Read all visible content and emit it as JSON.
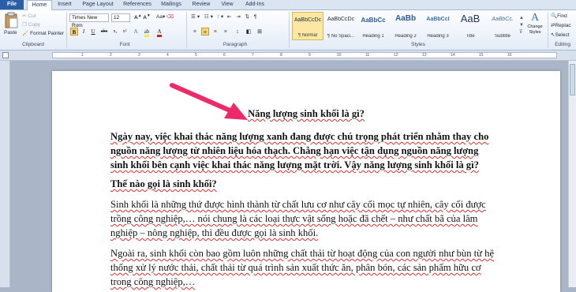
{
  "tabs": [
    "File",
    "Home",
    "Insert",
    "Page Layout",
    "References",
    "Mailings",
    "Review",
    "View",
    "Add-Ins"
  ],
  "clipboard": {
    "paste": "Paste",
    "cut": "Cut",
    "copy": "Copy",
    "format_painter": "Format Painter",
    "group": "Clipboard"
  },
  "font": {
    "name": "Times New Rom",
    "size": "12",
    "group": "Font"
  },
  "paragraph": {
    "group": "Paragraph"
  },
  "styles": {
    "items": [
      {
        "preview": "AaBbCcDc",
        "name": "¶ Normal"
      },
      {
        "preview": "AaBbCcDc",
        "name": "¶ No Spaci..."
      },
      {
        "preview": "AaBbCc",
        "name": "Heading 1"
      },
      {
        "preview": "AaBb",
        "name": "Heading 2"
      },
      {
        "preview": "AaBbCcI",
        "name": "Heading 3"
      },
      {
        "preview": "AaB",
        "name": "Title"
      },
      {
        "preview": "AaBbCc.",
        "name": "Subtitle"
      }
    ],
    "change_styles": "Change Styles",
    "group": "Styles"
  },
  "editing": {
    "find": "Find",
    "replace": "Replac",
    "select": "Select",
    "group": "Editing"
  },
  "doc": {
    "title": "Năng lượng sinh khối là gì?",
    "p1": [
      "Ngày nay, việc khai thác năng lượng xanh đang được chú trọng phát triển nhằm thay cho",
      "nguồn năng lượng từ nhiên liệu hóa thạch. Chẳng hạn việc tận dụng nguồn năng lượng",
      "sinh khối bên cạnh việc khai thác năng lượng mặt trời. Vậy năng lượng sinh khối là gì?"
    ],
    "h2": "Thế nào gọi là sinh khối?",
    "p2": [
      "Sinh khối là những thứ được hình thành từ chất lưu cơ như cây cối mọc tự nhiên, cây cối được",
      "trồng công nghiệp,… nói chung là các loại thực vật sống hoặc đã chết – như chất bã của lâm",
      "nghiệp – nông nghiệp, thì đều được gọi là sinh khối."
    ],
    "p3": [
      "Ngoài ra, sinh khối còn bao gồm luôn những chất thải từ hoạt động của con người như bùn từ hệ",
      "thống xử lý nước thải, chất thải từ quá trình sản xuất thức ăn, phân bón, các sản phẩm hữu cơ",
      "trong công nghiệp,…"
    ]
  },
  "ruler_ticks": [
    "1",
    "2",
    "3",
    "4",
    "5",
    "6",
    "7",
    "8",
    "9",
    "10",
    "11",
    "12",
    "13",
    "14",
    "15",
    "16"
  ],
  "colors": {
    "accent": "#2a5ea6",
    "arrow": "#ec2a6a",
    "spell": "#d9302a"
  }
}
